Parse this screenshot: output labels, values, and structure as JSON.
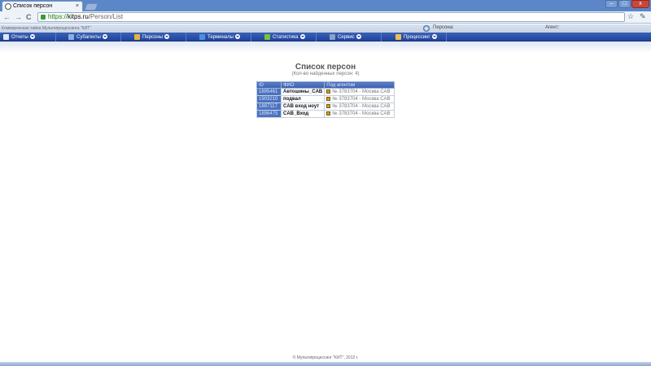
{
  "browser": {
    "tab_title": "Список персон",
    "tab_close": "×",
    "url_scheme": "https://",
    "url_host": "kitps.ru",
    "url_path": "/Person/List",
    "back_glyph": "←",
    "forward_glyph": "→",
    "reload_glyph": "C",
    "star_glyph": "☆",
    "wrench_glyph": "✎",
    "min_glyph": "–",
    "max_glyph": "□",
    "close_glyph": "x"
  },
  "site": {
    "tagline": "Коммерческая тайна Мультипроцессинга \"КИТ\"",
    "persons_label": "Персона:",
    "agent_label": "Агент:"
  },
  "menu": {
    "items": [
      {
        "label": "Отчеты",
        "icon": "reports-icon",
        "color": "#e0e8f8"
      },
      {
        "label": "Субагенты",
        "icon": "subagents-icon",
        "color": "#88b0e8"
      },
      {
        "label": "Персоны",
        "icon": "persons-icon",
        "color": "#e8b040"
      },
      {
        "label": "Терминалы",
        "icon": "terminals-icon",
        "color": "#4a90e0"
      },
      {
        "label": "Статистика",
        "icon": "statistics-icon",
        "color": "#7ac040"
      },
      {
        "label": "Сервис",
        "icon": "service-icon",
        "color": "#8aa0c8"
      },
      {
        "label": "Процессинг",
        "icon": "processing-icon",
        "color": "#e8c050"
      }
    ]
  },
  "content": {
    "title": "Список персон",
    "subtitle": "(Кол-во найденных персон: 4)",
    "columns": [
      "ID",
      "ФИО",
      "Под агентом"
    ],
    "rows": [
      {
        "id": "1895461",
        "name": "Автошины_CAB",
        "agent": "№ 3783704 - Москва CAB"
      },
      {
        "id": "1903210",
        "name": "подвал",
        "agent": "№ 3783704 - Москва CAB"
      },
      {
        "id": "1897117",
        "name": "CAB вход ноут",
        "agent": "№ 3783704 - Москва CAB"
      },
      {
        "id": "1896475",
        "name": "CAB_Вход",
        "agent": "№ 3783704 - Москва CAB"
      }
    ]
  },
  "footer": {
    "text": "© Мультипроцессинг \"КИТ\", 2012 г."
  }
}
